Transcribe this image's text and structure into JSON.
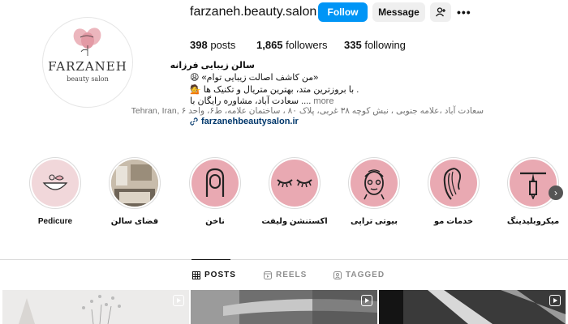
{
  "profile": {
    "username": "farzaneh.beauty.salon",
    "avatar_title": "FARZANEH",
    "avatar_subtitle": "beauty salon",
    "follow_label": "Follow",
    "message_label": "Message",
    "posts_count": "398",
    "posts_label": "posts",
    "followers_count": "1,865",
    "followers_label": "followers",
    "following_count": "335",
    "following_label": "following"
  },
  "bio": {
    "name": "سالن زیبایی فرزانه",
    "line1": "«من کاشف اصالت زیبایی توام»",
    "line1_emoji": "😩",
    "line2": "با بروزترین متد، بهترین متریال و تکنیک ها .",
    "line2_emoji": "💁",
    "line3": "سعادت آباد، مشاوره رایگان با ....",
    "more_label": "more",
    "address": "سعادت آباد ،علامه جنوبی ، نبش کوچه ۳۸ غربی، پلاک ۸۰ ، ساختمان علامه، ط۶، واحد ۶ ,Tehran, Iran",
    "link": "farzanehbeautysalon.ir"
  },
  "highlights": [
    {
      "label": "Pedicure"
    },
    {
      "label": "فضای سالن"
    },
    {
      "label": "ناخن"
    },
    {
      "label": "اکستنشن ولیفت"
    },
    {
      "label": "بیوتی تراپی"
    },
    {
      "label": "خدمات مو"
    },
    {
      "label": "میکروبلیدینگ"
    }
  ],
  "tabs": {
    "posts": "POSTS",
    "reels": "REELS",
    "tagged": "TAGGED"
  },
  "colors": {
    "accent": "#0095f6",
    "highlight_pink": "#e9a9b2",
    "link": "#00376b"
  }
}
